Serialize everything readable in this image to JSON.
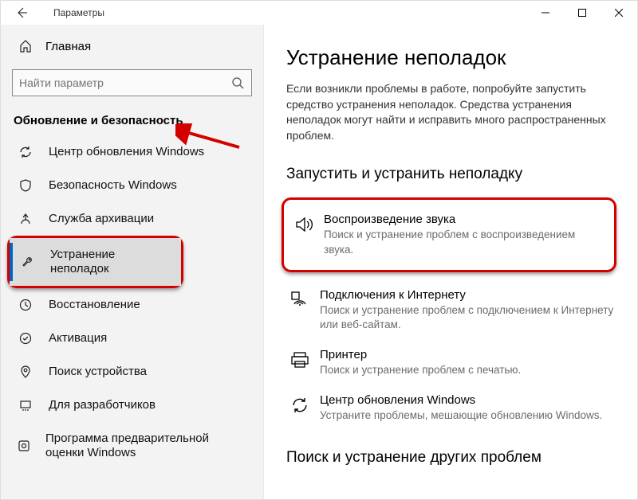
{
  "titlebar": {
    "title": "Параметры"
  },
  "sidebar": {
    "home": "Главная",
    "search_placeholder": "Найти параметр",
    "section": "Обновление и безопасность",
    "items": [
      {
        "label": "Центр обновления Windows"
      },
      {
        "label": "Безопасность Windows"
      },
      {
        "label": "Служба архивации"
      },
      {
        "label": "Устранение неполадок"
      },
      {
        "label": "Восстановление"
      },
      {
        "label": "Активация"
      },
      {
        "label": "Поиск устройства"
      },
      {
        "label": "Для разработчиков"
      },
      {
        "label": "Программа предварительной оценки Windows"
      }
    ]
  },
  "content": {
    "heading": "Устранение неполадок",
    "intro": "Если возникли проблемы в работе, попробуйте запустить средство устранения неполадок. Средства устранения неполадок могут найти и исправить много распространенных проблем.",
    "section1": "Запустить и устранить неполадку",
    "items": [
      {
        "title": "Воспроизведение звука",
        "desc": "Поиск и устранение проблем с воспроизведением звука."
      },
      {
        "title": "Подключения к Интернету",
        "desc": "Поиск и устранение проблем с подключением к Интернету или веб-сайтам."
      },
      {
        "title": "Принтер",
        "desc": "Поиск и устранение проблем с печатью."
      },
      {
        "title": "Центр обновления Windows",
        "desc": "Устраните проблемы, мешающие обновлению Windows."
      }
    ],
    "section2": "Поиск и устранение других проблем"
  }
}
